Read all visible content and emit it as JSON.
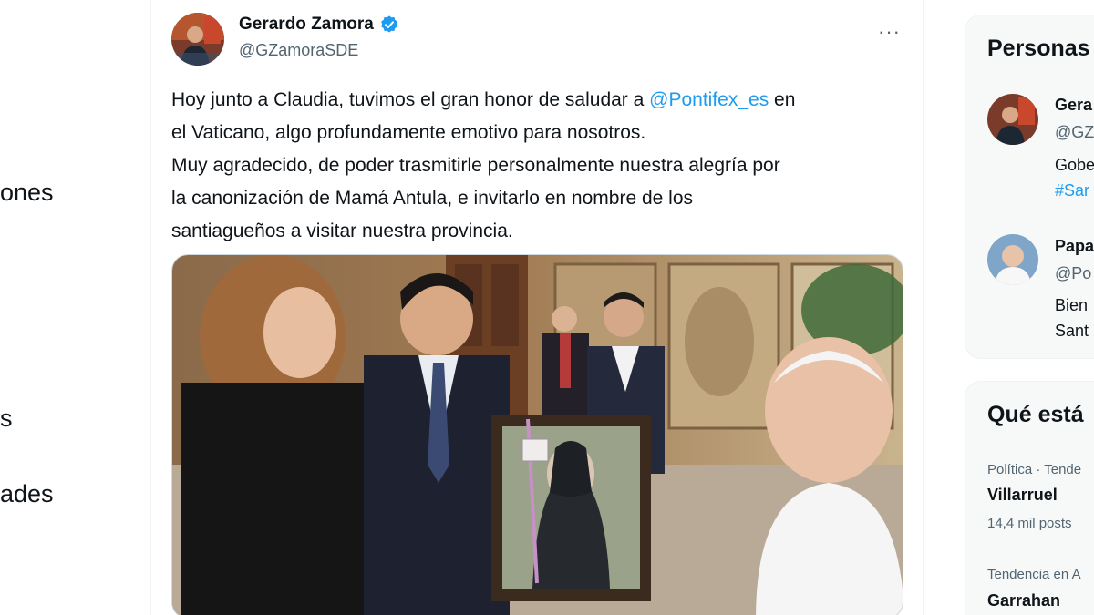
{
  "nav": {
    "items": [
      "ones",
      "s",
      "ades"
    ]
  },
  "tweet": {
    "author_name": "Gerardo Zamora",
    "author_handle": "@GZamoraSDE",
    "more_label": "···",
    "text_lines": [
      [
        "Hoy junto a Claudia, tuvimos el gran honor de saludar a ",
        "@Pontifex_es",
        " en"
      ],
      "el Vaticano, algo  profundamente emotivo para nosotros.",
      "Muy agradecido, de poder trasmitirle personalmente nuestra alegría por",
      "la canonización de Mamá Antula, e invitarlo en nombre de los",
      "santiagueños a visitar nuestra provincia."
    ]
  },
  "sidebar": {
    "people_title": "Personas",
    "people": [
      {
        "name": "Gera",
        "handle": "@GZ",
        "bio_line1": "Gobe",
        "bio_line2": "#Sar"
      },
      {
        "name": "Papa",
        "handle": "@Po",
        "bio_line1": "Bien",
        "bio_line2": "Sant"
      }
    ],
    "trends_title": "Qué está",
    "trends": [
      {
        "meta": "Política · Tende",
        "name": "Villarruel",
        "count": "14,4 mil posts"
      },
      {
        "meta": "Tendencia en A",
        "name": "Garrahan"
      }
    ]
  },
  "colors": {
    "accent": "#1d9bf0",
    "secondary_text": "#536471",
    "border": "#eff3f4"
  }
}
